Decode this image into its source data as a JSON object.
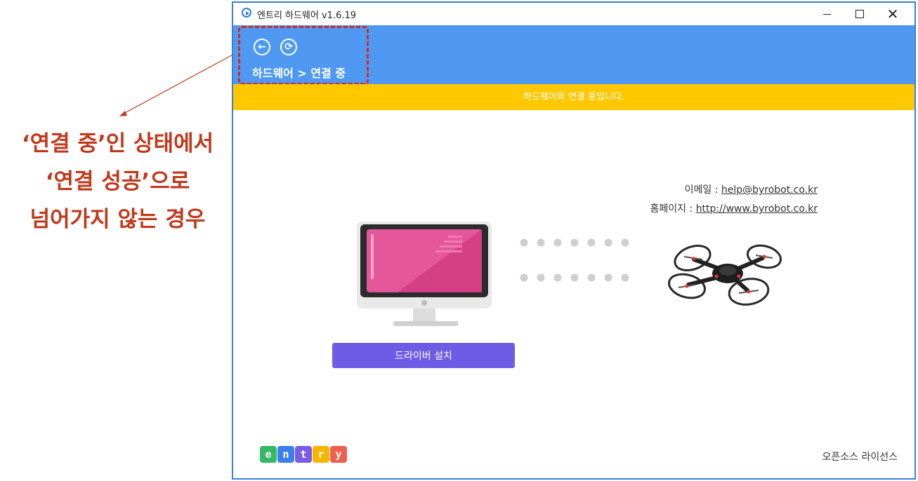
{
  "annotation": {
    "lines": [
      "‘연결 중’인 상태에서",
      "‘연결 성공’으로",
      "넘어가지 않는 경우"
    ]
  },
  "window": {
    "title": "엔트리 하드웨어 v1.6.19",
    "controls": {
      "minimize": "minimize",
      "maximize": "maximize",
      "close": "✕"
    }
  },
  "header": {
    "back_icon": "←",
    "refresh_icon": "⟳",
    "breadcrumb": "하드웨어 > 연결 중"
  },
  "status": {
    "message": "하드웨어와 연결 중입니다."
  },
  "contact": {
    "email_label": "이메일 : ",
    "email": "help@byrobot.co.kr",
    "homepage_label": "홈페이지 : ",
    "homepage": "http://www.byrobot.co.kr"
  },
  "driver_button": {
    "label": "드라이버 설치"
  },
  "logo": {
    "letters": [
      "e",
      "n",
      "t",
      "r",
      "y"
    ]
  },
  "footer": {
    "license": "오픈소스 라이선스"
  },
  "colors": {
    "header": "#4f99f3",
    "status": "#ffc800",
    "button": "#6f5ce6",
    "annotation": "#c0391c"
  }
}
